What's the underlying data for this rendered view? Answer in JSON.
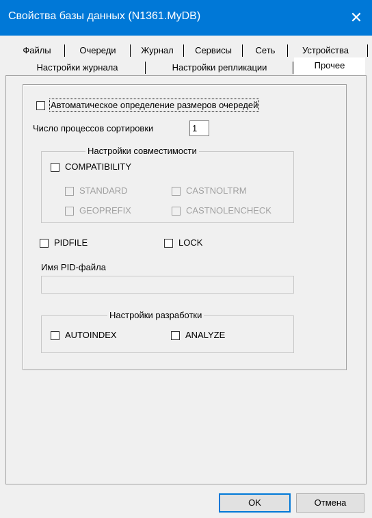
{
  "window": {
    "title": "Свойства базы данных (N1361.MyDB)"
  },
  "tabs": {
    "row1": [
      "Файлы",
      "Очереди",
      "Журнал",
      "Сервисы",
      "Сеть",
      "Устройства"
    ],
    "row2": [
      "Настройки журнала",
      "Настройки репликации",
      "Прочее"
    ],
    "selected": "Прочее"
  },
  "options": {
    "auto_queue_size": {
      "label": "Автоматическое определение размеров очередей",
      "checked": false
    },
    "sort_processes": {
      "label": "Число процессов сортировки",
      "value": "1"
    }
  },
  "compat": {
    "legend": "Настройки совместимости",
    "compatibility": {
      "label": "COMPATIBILITY",
      "checked": false
    },
    "standard": {
      "label": "STANDARD",
      "checked": false,
      "enabled": false
    },
    "castnoltrm": {
      "label": "CASTNOLTRM",
      "checked": false,
      "enabled": false
    },
    "geoprefix": {
      "label": "GEOPREFIX",
      "checked": false,
      "enabled": false
    },
    "castnolencheck": {
      "label": "CASTNOLENCHECK",
      "checked": false,
      "enabled": false
    }
  },
  "pidfile": {
    "label": "PIDFILE",
    "checked": false
  },
  "lock": {
    "label": "LOCK",
    "checked": false
  },
  "pid_name": {
    "label": "Имя PID-файла",
    "value": ""
  },
  "dev": {
    "legend": "Настройки разработки",
    "autoindex": {
      "label": "AUTOINDEX",
      "checked": false
    },
    "analyze": {
      "label": "ANALYZE",
      "checked": false
    }
  },
  "buttons": {
    "ok": "OK",
    "cancel": "Отмена"
  }
}
